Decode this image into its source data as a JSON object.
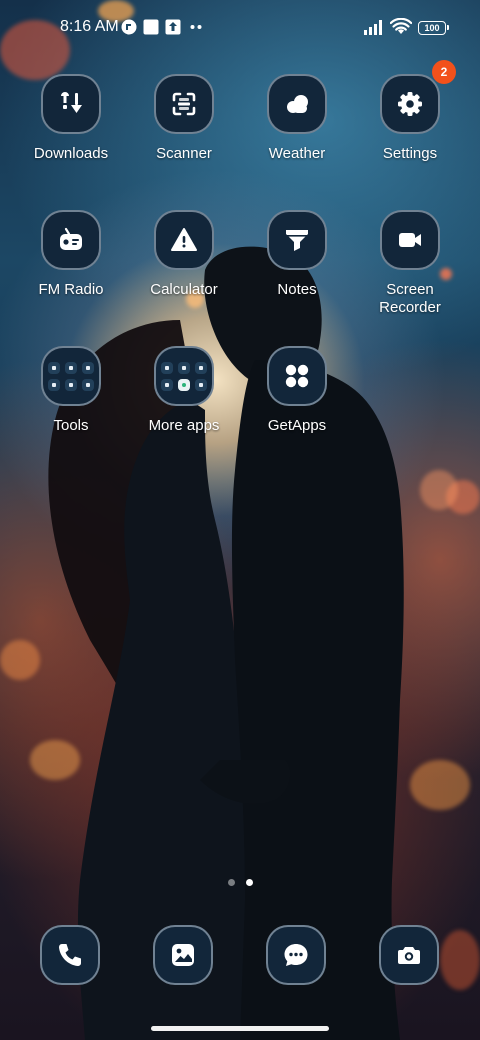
{
  "status_bar": {
    "time": "8:16 AM",
    "battery": "100"
  },
  "apps": [
    {
      "label": "Downloads",
      "icon": "downloads-icon"
    },
    {
      "label": "Scanner",
      "icon": "scanner-icon"
    },
    {
      "label": "Weather",
      "icon": "weather-icon"
    },
    {
      "label": "Settings",
      "icon": "settings-icon",
      "badge": "2"
    },
    {
      "label": "FM Radio",
      "icon": "radio-icon"
    },
    {
      "label": "Calculator",
      "icon": "calculator-icon"
    },
    {
      "label": "Notes",
      "icon": "notes-icon"
    },
    {
      "label": "Screen\nRecorder",
      "icon": "screen-recorder-icon"
    },
    {
      "label": "Tools",
      "icon": "tools-folder-icon"
    },
    {
      "label": "More apps",
      "icon": "more-apps-folder-icon"
    },
    {
      "label": "GetApps",
      "icon": "getapps-icon"
    }
  ],
  "page_indicator": {
    "pages": 2,
    "current": 2
  },
  "dock": [
    {
      "icon": "phone-icon"
    },
    {
      "icon": "gallery-icon"
    },
    {
      "icon": "messages-icon"
    },
    {
      "icon": "camera-icon"
    }
  ],
  "colors": {
    "icon_bg": "#12263a",
    "badge": "#f2511b",
    "accent_orange": "#f2511b"
  }
}
